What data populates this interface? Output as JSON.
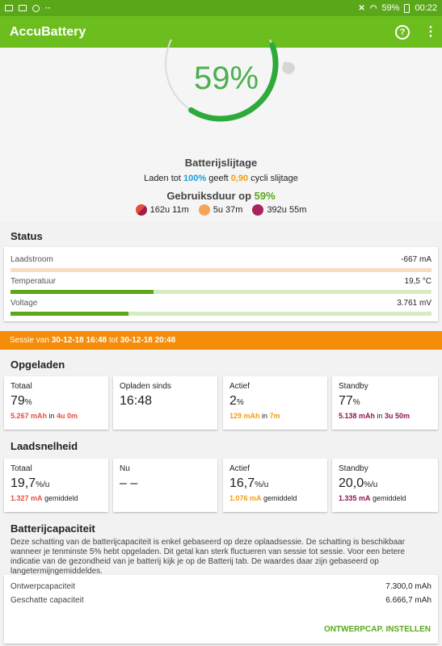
{
  "statusbar": {
    "battery": "59%",
    "time": "00:22"
  },
  "app": {
    "title": "AccuBattery",
    "accent": "#6cbe1e"
  },
  "hero": {
    "percent_text": "59%",
    "percent": 59,
    "wear_title": "Batterijslijtage",
    "wear_pre": "Laden tot ",
    "wear_charge": "100%",
    "wear_mid": " geeft ",
    "wear_cycles": "0,90",
    "wear_post": " cycli slijtage",
    "usage_pre": "Gebruiksduur op ",
    "usage_pct": "59%",
    "usage_items": [
      {
        "icon": "screen-on-icon",
        "value": "162u 11m"
      },
      {
        "icon": "sun-icon",
        "value": "5u 37m"
      },
      {
        "icon": "sleep-icon",
        "value": "392u 55m"
      }
    ]
  },
  "status": {
    "title": "Status",
    "rows": [
      {
        "label": "Laadstroom",
        "value": "-667 mA",
        "level": 0
      },
      {
        "label": "Temperatuur",
        "value": "19,5 °C",
        "level": 0.34
      },
      {
        "label": "Voltage",
        "value": "3.761 mV",
        "level": 0.28
      }
    ]
  },
  "session": {
    "pre": "Sessie van ",
    "start": "30-12-18 16:48",
    "mid": " tot ",
    "end": "30-12-18 20:48"
  },
  "charged": {
    "title": "Opgeladen",
    "cards": [
      {
        "label": "Totaal",
        "value": "79",
        "unit": "%",
        "amount": "5.267 mAh",
        "sep": " in ",
        "dur": "4u 0m"
      },
      {
        "label": "Opladen sinds",
        "value": "16:48"
      },
      {
        "label": "Actief",
        "value": "2",
        "unit": "%",
        "amount": "129 mAh",
        "sep": " in ",
        "dur": "7m"
      },
      {
        "label": "Standby",
        "value": "77",
        "unit": "%",
        "amount": "5.138 mAh",
        "sep": " in ",
        "dur": "3u 50m"
      }
    ]
  },
  "rate": {
    "title": "Laadsnelheid",
    "cards": [
      {
        "label": "Totaal",
        "value": "19,7",
        "unit": "%/u",
        "amount": "1.327 mA",
        "suffix": " gemiddeld"
      },
      {
        "label": "Nu",
        "value": "– –"
      },
      {
        "label": "Actief",
        "value": "16,7",
        "unit": "%/u",
        "amount": "1.076 mA",
        "suffix": " gemiddeld"
      },
      {
        "label": "Standby",
        "value": "20,0",
        "unit": "%/u",
        "amount": "1.335 mA",
        "suffix": " gemiddeld"
      }
    ]
  },
  "capacity": {
    "title": "Batterijcapaciteit",
    "description": "Deze schatting van de batterijcapaciteit is enkel gebaseerd op deze oplaadsessie. De schatting is beschikbaar wanneer je tenminste 5% hebt opgeladen. Dit getal kan sterk fluctueren van sessie tot sessie. Voor een betere indicatie van de gezondheid van je batterij kijk je op de Batterij tab. De waardes daar zijn gebaseerd op langetermijngemiddeldes.",
    "rows": [
      {
        "label": "Ontwerpcapaciteit",
        "value": "7.300,0 mAh"
      },
      {
        "label": "Geschatte capaciteit",
        "value": "6.666,7 mAh"
      }
    ],
    "button": "ONTWERPCAP. INSTELLEN"
  }
}
